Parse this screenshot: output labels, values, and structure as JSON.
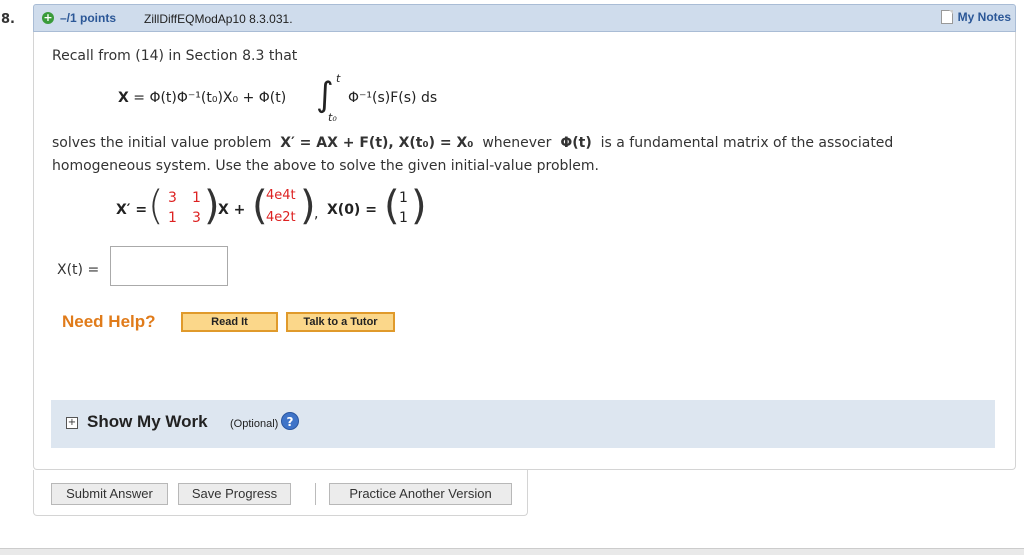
{
  "question": {
    "number": "8.",
    "points": "–/1 points",
    "id": "ZillDiffEQModAp10 8.3.031.",
    "my_notes": "My Notes"
  },
  "content": {
    "intro": "Recall from (14) in Section 8.3 that",
    "formula": {
      "lhs": "X",
      "rhs1": "Φ(t)Φ⁻¹(t₀)X₀",
      "rhs2": "Φ(t)",
      "integral_upper": "t",
      "integral_lower": "t₀",
      "integrand": "Φ⁻¹(s)F(s) ds"
    },
    "paragraph_line1": "solves the initial value problem",
    "paragraph_eq": "X′ = AX + F(t), X(t₀) = X₀",
    "paragraph_whenever": "whenever",
    "paragraph_phi": "Φ(t)",
    "paragraph_rest": "is a fundamental matrix of the associated",
    "paragraph_line2": "homogeneous system. Use the above to solve the given initial-value problem.",
    "system": {
      "lhs": "X′ =",
      "matrix_a": [
        [
          "3",
          "1"
        ],
        [
          "1",
          "3"
        ]
      ],
      "times_x": "X +",
      "forcing": [
        "4e4t",
        "4e2t"
      ],
      "initial_label": "X(0) =",
      "initial_value": [
        "1",
        "1"
      ]
    }
  },
  "answer": {
    "label": "X(t) =",
    "value": ""
  },
  "help": {
    "need_help": "Need Help?",
    "read_it": "Read It",
    "talk_to_tutor": "Talk to a Tutor"
  },
  "show_work": {
    "title": "Show My Work",
    "optional": "(Optional)"
  },
  "actions": {
    "submit": "Submit Answer",
    "save": "Save Progress",
    "practice": "Practice Another Version"
  },
  "colors": {
    "header_bg": "#cfdcec",
    "points_blue": "#2b5797",
    "help_orange": "#e07b1a",
    "matrix_red": "#dd2222"
  }
}
